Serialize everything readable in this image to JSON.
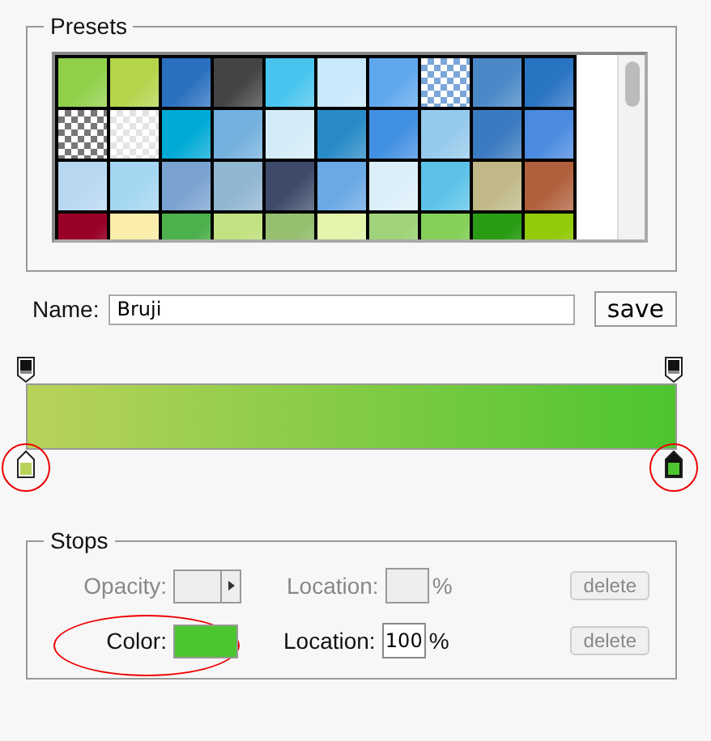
{
  "presets": {
    "legend": "Presets",
    "swatches": [
      {
        "kind": "gradient",
        "color": "#8fd048"
      },
      {
        "kind": "gradient",
        "color": "#b4d44a"
      },
      {
        "kind": "gradient",
        "color": "#2a70c0"
      },
      {
        "kind": "gradient",
        "color": "#444444"
      },
      {
        "kind": "gradient",
        "color": "#48c4ee"
      },
      {
        "kind": "gradient",
        "color": "#c8e8fb"
      },
      {
        "kind": "gradient",
        "color": "#60a8ee"
      },
      {
        "kind": "checker",
        "color": "#7aa6d8"
      },
      {
        "kind": "gradient",
        "color": "#4a88c8"
      },
      {
        "kind": "gradient",
        "color": "#2a74c4"
      },
      {
        "kind": "checker",
        "color": "#777777"
      },
      {
        "kind": "checker",
        "color": "#e4e4e4"
      },
      {
        "kind": "gradient",
        "color": "#00aad6"
      },
      {
        "kind": "gradient",
        "color": "#74b0de"
      },
      {
        "kind": "gradient",
        "color": "#d4ecf8"
      },
      {
        "kind": "gradient",
        "color": "#288bc7"
      },
      {
        "kind": "gradient",
        "color": "#4290e3"
      },
      {
        "kind": "gradient",
        "color": "#96caec"
      },
      {
        "kind": "gradient",
        "color": "#3a7ac0"
      },
      {
        "kind": "gradient",
        "color": "#4a8ae0"
      },
      {
        "kind": "gradient",
        "color": "#b8d8f2"
      },
      {
        "kind": "gradient",
        "color": "#a4d6f2"
      },
      {
        "kind": "gradient",
        "color": "#7aa2d0"
      },
      {
        "kind": "gradient",
        "color": "#90b6d2"
      },
      {
        "kind": "gradient",
        "color": "#3e4b6b"
      },
      {
        "kind": "gradient",
        "color": "#6aa8e6"
      },
      {
        "kind": "gradient",
        "color": "#dceff9"
      },
      {
        "kind": "gradient",
        "color": "#5cc2e8"
      },
      {
        "kind": "gradient",
        "color": "#c0b886"
      },
      {
        "kind": "gradient",
        "color": "#b0603c"
      },
      {
        "kind": "gradient",
        "color": "#980026"
      },
      {
        "kind": "gradient",
        "color": "#faeeaa"
      },
      {
        "kind": "gradient",
        "color": "#4cb04c"
      },
      {
        "kind": "gradient",
        "color": "#c2e282"
      },
      {
        "kind": "gradient",
        "color": "#96c070"
      },
      {
        "kind": "gradient",
        "color": "#e4f4aa"
      },
      {
        "kind": "gradient",
        "color": "#a0d37a"
      },
      {
        "kind": "gradient",
        "color": "#84d058"
      },
      {
        "kind": "gradient",
        "color": "#2a9c14"
      },
      {
        "kind": "gradient",
        "color": "#92ca08"
      }
    ]
  },
  "name": {
    "label": "Name:",
    "value": "Bruji"
  },
  "save_button": "save",
  "opacity_stops": [
    {
      "level": 0
    },
    {
      "level": 1
    }
  ],
  "color_stops": [
    {
      "level": 0,
      "color": "#b9d25a",
      "selected": false,
      "annotated": true
    },
    {
      "level": 1,
      "color": "#4dc52f",
      "selected": true,
      "annotated": true
    }
  ],
  "stops": {
    "legend": "Stops",
    "rows": [
      {
        "kind": "opacity",
        "label": "Opacity:",
        "location_label": "Location:",
        "unit": "%",
        "delete": "delete",
        "disabled": true,
        "annotated": false
      },
      {
        "kind": "color",
        "label": "Color:",
        "color": "#4dc52f",
        "location_label": "Location:",
        "location": "100",
        "unit": "%",
        "delete": "delete",
        "disabled": false,
        "annotated": true
      }
    ]
  }
}
